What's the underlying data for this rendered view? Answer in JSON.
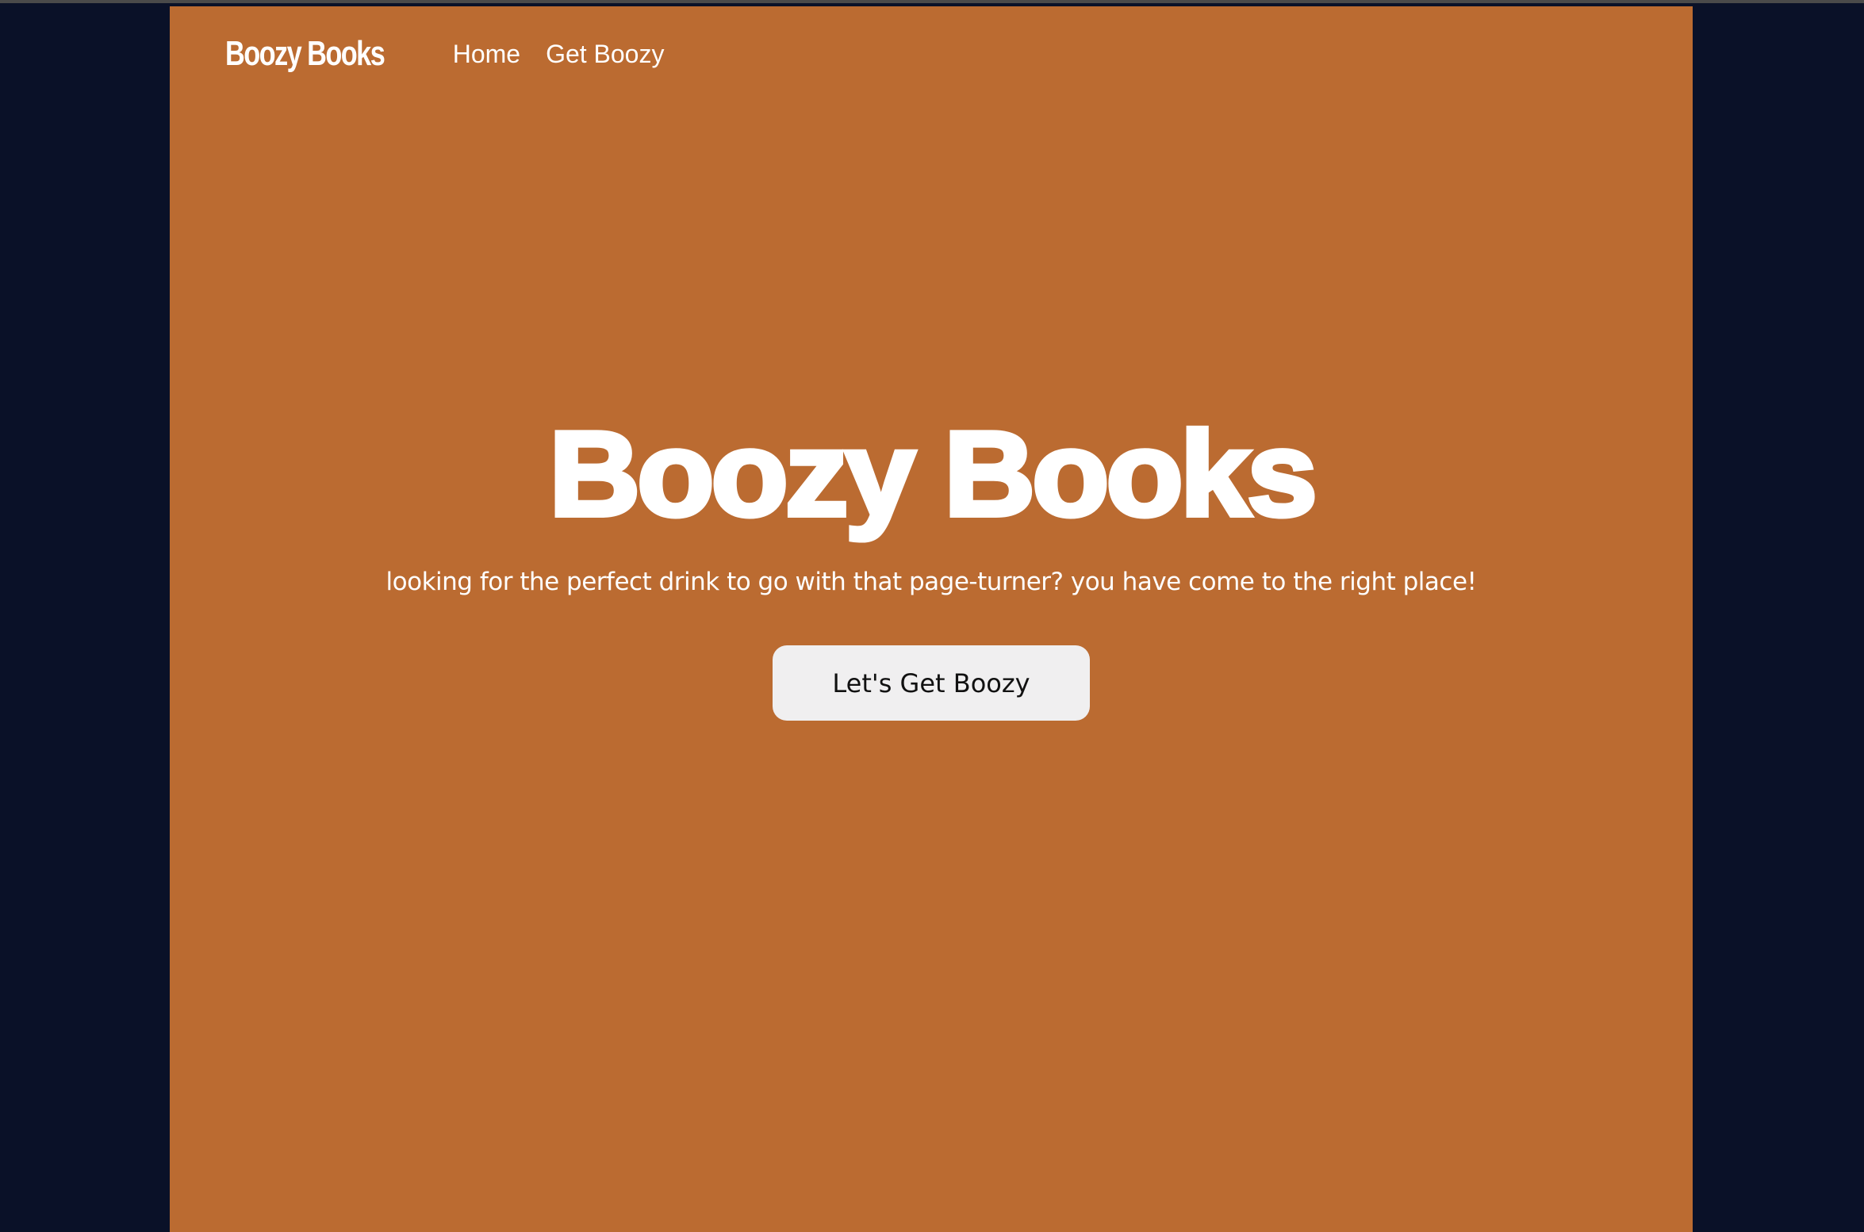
{
  "navbar": {
    "brand": "Boozy Books",
    "links": [
      {
        "label": "Home"
      },
      {
        "label": "Get Boozy"
      }
    ]
  },
  "hero": {
    "title": "Boozy Books",
    "subtitle": "looking for the perfect drink to go with that page-turner? you have come to the right place!",
    "cta_label": "Let's Get Boozy"
  },
  "colors": {
    "page_background": "#bb6b31",
    "outer_background": "#0a1128",
    "text": "#ffffff",
    "button_background": "#f0eff0",
    "button_text": "#111111"
  }
}
